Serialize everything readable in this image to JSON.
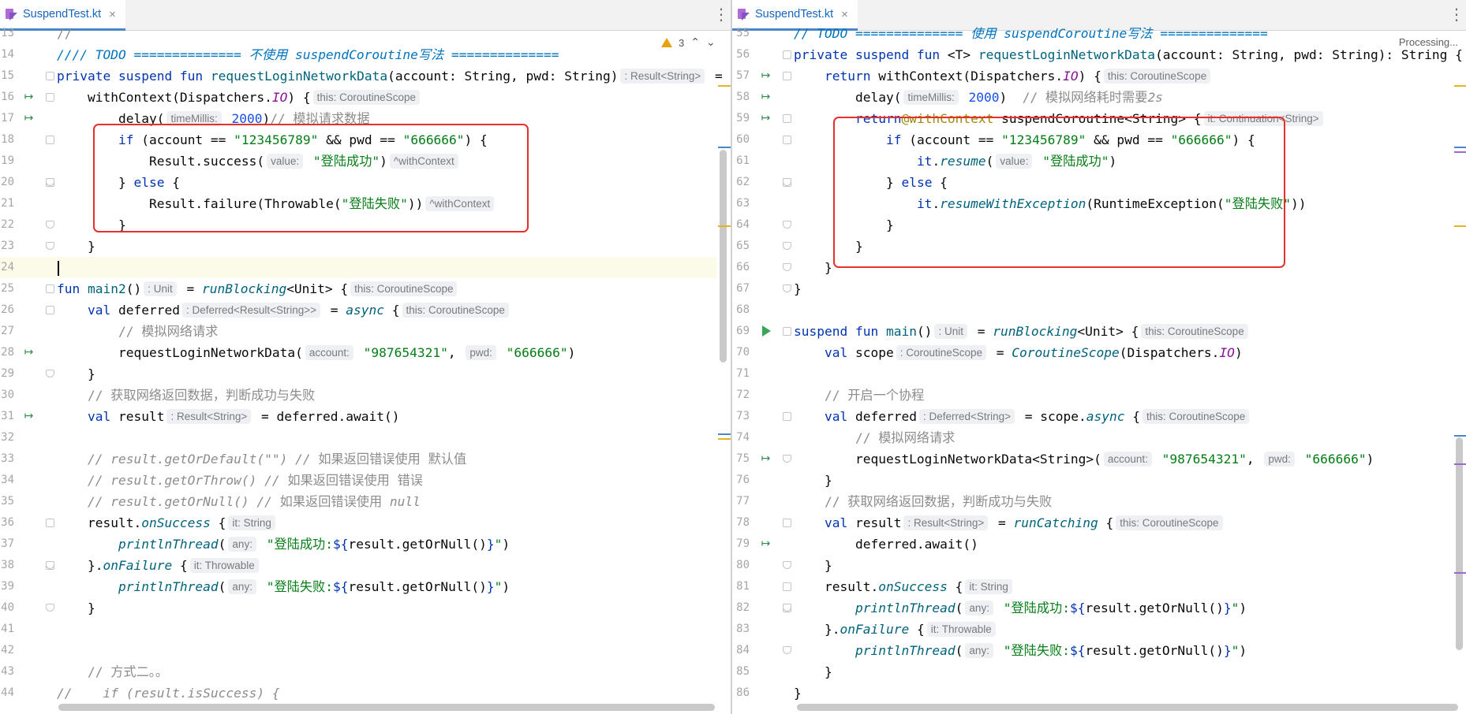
{
  "left": {
    "tab": {
      "label": "SuspendTest.kt",
      "close": "×"
    },
    "warnings": {
      "count": "3",
      "up": "⌃",
      "down": "⌄"
    },
    "lines": [
      {
        "n": "13",
        "html": "<span class='cm'>//</span>"
      },
      {
        "n": "14",
        "html": "<span class='cm-todo'>//// TODO ============== 不使用 suspendCoroutine写法 ==============</span>"
      },
      {
        "n": "15",
        "html": "<span class='kw'>private suspend fun </span><span class='fn'>requestLoginNetworkData</span>(account: String, pwd: String)<span class='hint'>: Result&lt;String&gt;</span> ="
      },
      {
        "n": "16",
        "html": "    withContext(Dispatchers.<span class='pf it'>IO</span>) {<span class='hint'>this: CoroutineScope</span>",
        "icon": "suspend"
      },
      {
        "n": "17",
        "html": "        delay(<span class='hint'>timeMillis:</span> <span class='num'>2000</span>)<span class='cm'>// 模拟请求数据</span>",
        "icon": "suspend"
      },
      {
        "n": "18",
        "html": "        <span class='kw'>if</span> (account == <span class='str'>\"123456789\"</span> &amp;&amp; pwd == <span class='str'>\"666666\"</span>) {"
      },
      {
        "n": "19",
        "html": "            Result.success(<span class='hint'>value:</span> <span class='str'>\"登陆成功\"</span>)<span class='hint'>^withContext</span>"
      },
      {
        "n": "20",
        "html": "        } <span class='kw'>else</span> {"
      },
      {
        "n": "21",
        "html": "            Result.failure(Throwable(<span class='str'>\"登陆失败\"</span>))<span class='hint'>^withContext</span>"
      },
      {
        "n": "22",
        "html": "        }"
      },
      {
        "n": "23",
        "html": "    }"
      },
      {
        "n": "24",
        "html": "",
        "current": true
      },
      {
        "n": "25",
        "html": "<span class='kw'>fun </span><span class='fn'>main2</span>()<span class='hint'>: Unit</span> = <span class='ext'>runBlocking</span>&lt;Unit&gt; {<span class='hint'>this: CoroutineScope</span>"
      },
      {
        "n": "26",
        "html": "    <span class='kw'>val </span>deferred<span class='hint'>: Deferred&lt;Result&lt;String&gt;&gt;</span> = <span class='ext'>async</span> {<span class='hint'>this: CoroutineScope</span>"
      },
      {
        "n": "27",
        "html": "        <span class='cm'>// 模拟网络请求</span>"
      },
      {
        "n": "28",
        "html": "        requestLoginNetworkData(<span class='hint'>account:</span> <span class='str'>\"987654321\"</span>, <span class='hint'>pwd:</span> <span class='str'>\"666666\"</span>)",
        "icon": "suspend"
      },
      {
        "n": "29",
        "html": "    }"
      },
      {
        "n": "30",
        "html": "    <span class='cm'>// 获取网络返回数据，判断成功与失败</span>"
      },
      {
        "n": "31",
        "html": "    <span class='kw'>val </span>result<span class='hint'>: Result&lt;String&gt;</span> = deferred.await()",
        "icon": "suspend"
      },
      {
        "n": "32",
        "html": ""
      },
      {
        "n": "33",
        "html": "    <span class='cm it'>// result.getOrDefault(\"\") // </span><span class='cm'>如果返回错误使用 默认值</span>"
      },
      {
        "n": "34",
        "html": "    <span class='cm it'>// result.getOrThrow() // </span><span class='cm'>如果返回错误使用 错误</span>"
      },
      {
        "n": "35",
        "html": "    <span class='cm it'>// result.getOrNull() // </span><span class='cm'>如果返回错误使用 </span><span class='cm it'>null</span>"
      },
      {
        "n": "36",
        "html": "    result.<span class='ext'>onSuccess</span> {<span class='hint'>it: String</span>"
      },
      {
        "n": "37",
        "html": "        <span class='ext'>printlnThread</span>(<span class='hint'>any:</span> <span class='str'>\"登陆成功:</span><span class='kw'>${</span>result.getOrNull()<span class='kw'>}</span><span class='str'>\"</span>)"
      },
      {
        "n": "38",
        "html": "    }.<span class='ext'>onFailure</span> {<span class='hint'>it: Throwable</span>"
      },
      {
        "n": "39",
        "html": "        <span class='ext'>printlnThread</span>(<span class='hint'>any:</span> <span class='str'>\"登陆失败:</span><span class='kw'>${</span>result.getOrNull()<span class='kw'>}</span><span class='str'>\"</span>)"
      },
      {
        "n": "40",
        "html": "    }"
      },
      {
        "n": "41",
        "html": ""
      },
      {
        "n": "42",
        "html": ""
      },
      {
        "n": "43",
        "html": "    <span class='cm'>// 方式二。。</span>"
      },
      {
        "n": "44",
        "html": "<span class='cm it'>//    if (result.isSuccess) {</span>"
      }
    ]
  },
  "right": {
    "tab": {
      "label": "SuspendTest.kt",
      "close": "×"
    },
    "status": "Processing...",
    "lines": [
      {
        "n": "55",
        "html": "<span class='cm-todo'>// TODO ============== 使用 suspendCoroutine写法 ==============</span>"
      },
      {
        "n": "56",
        "html": "<span class='kw'>private suspend fun </span>&lt;T&gt; <span class='fn'>requestLoginNetworkData</span>(account: String, pwd: String): String {"
      },
      {
        "n": "57",
        "html": "    <span class='kw'>return </span>withContext(Dispatchers.<span class='pf it'>IO</span>) {<span class='hint'>this: CoroutineScope</span>",
        "icon": "suspend"
      },
      {
        "n": "58",
        "html": "        delay(<span class='hint'>timeMillis:</span> <span class='num'>2000</span>)  <span class='cm'>// 模拟网络耗时需要</span><span class='cm it'>2s</span>",
        "icon": "suspend"
      },
      {
        "n": "59",
        "html": "        <span class='kw'>return</span><span class='lbl'>@withContext</span> suspendCoroutine&lt;String&gt; {<span class='hint'>it: Continuation&lt;String&gt;</span>",
        "icon": "suspend"
      },
      {
        "n": "60",
        "html": "            <span class='kw'>if</span> (account == <span class='str'>\"123456789\"</span> &amp;&amp; pwd == <span class='str'>\"666666\"</span>) {"
      },
      {
        "n": "61",
        "html": "                <span class='kw'>it</span>.<span class='ext'>resume</span>(<span class='hint'>value:</span> <span class='str'>\"登陆成功\"</span>)"
      },
      {
        "n": "62",
        "html": "            } <span class='kw'>else</span> {"
      },
      {
        "n": "63",
        "html": "                <span class='kw'>it</span>.<span class='ext'>resumeWithException</span>(RuntimeException(<span class='str'>\"登陆失败\"</span>))"
      },
      {
        "n": "64",
        "html": "            }"
      },
      {
        "n": "65",
        "html": "        }"
      },
      {
        "n": "66",
        "html": "    }"
      },
      {
        "n": "67",
        "html": "}"
      },
      {
        "n": "68",
        "html": ""
      },
      {
        "n": "69",
        "html": "<span class='kw'>suspend fun </span><span class='fn'>main</span>()<span class='hint'>: Unit</span> = <span class='ext'>runBlocking</span>&lt;Unit&gt; {<span class='hint'>this: CoroutineScope</span>",
        "icon": "run"
      },
      {
        "n": "70",
        "html": "    <span class='kw'>val </span>scope<span class='hint'>: CoroutineScope</span> = <span class='ext'>CoroutineScope</span>(Dispatchers.<span class='pf it'>IO</span>)"
      },
      {
        "n": "71",
        "html": ""
      },
      {
        "n": "72",
        "html": "    <span class='cm'>// 开启一个协程</span>"
      },
      {
        "n": "73",
        "html": "    <span class='kw'>val </span>deferred<span class='hint'>: Deferred&lt;String&gt;</span> = scope.<span class='ext'>async</span> {<span class='hint'>this: CoroutineScope</span>"
      },
      {
        "n": "74",
        "html": "        <span class='cm'>// 模拟网络请求</span>"
      },
      {
        "n": "75",
        "html": "        requestLoginNetworkData&lt;String&gt;(<span class='hint'>account:</span> <span class='str'>\"987654321\"</span>, <span class='hint'>pwd:</span> <span class='str'>\"666666\"</span>)",
        "icon": "suspend"
      },
      {
        "n": "76",
        "html": "    }"
      },
      {
        "n": "77",
        "html": "    <span class='cm'>// 获取网络返回数据，判断成功与失败</span>"
      },
      {
        "n": "78",
        "html": "    <span class='kw'>val </span>result<span class='hint'>: Result&lt;String&gt;</span> = <span class='ext'>runCatching</span> {<span class='hint'>this: CoroutineScope</span>"
      },
      {
        "n": "79",
        "html": "        deferred.await()",
        "icon": "suspend"
      },
      {
        "n": "80",
        "html": "    }"
      },
      {
        "n": "81",
        "html": "    result.<span class='ext'>onSuccess</span> {<span class='hint'>it: String</span>"
      },
      {
        "n": "82",
        "html": "        <span class='ext'>printlnThread</span>(<span class='hint'>any:</span> <span class='str'>\"登陆成功:</span><span class='kw'>${</span>result.getOrNull()<span class='kw'>}</span><span class='str'>\"</span>)"
      },
      {
        "n": "83",
        "html": "    }.<span class='ext'>onFailure</span> {<span class='hint'>it: Throwable</span>"
      },
      {
        "n": "84",
        "html": "        <span class='ext'>printlnThread</span>(<span class='hint'>any:</span> <span class='str'>\"登陆失败:</span><span class='kw'>${</span>result.getOrNull()<span class='kw'>}</span><span class='str'>\"</span>)"
      },
      {
        "n": "85",
        "html": "    }"
      },
      {
        "n": "86",
        "html": "}"
      }
    ]
  }
}
